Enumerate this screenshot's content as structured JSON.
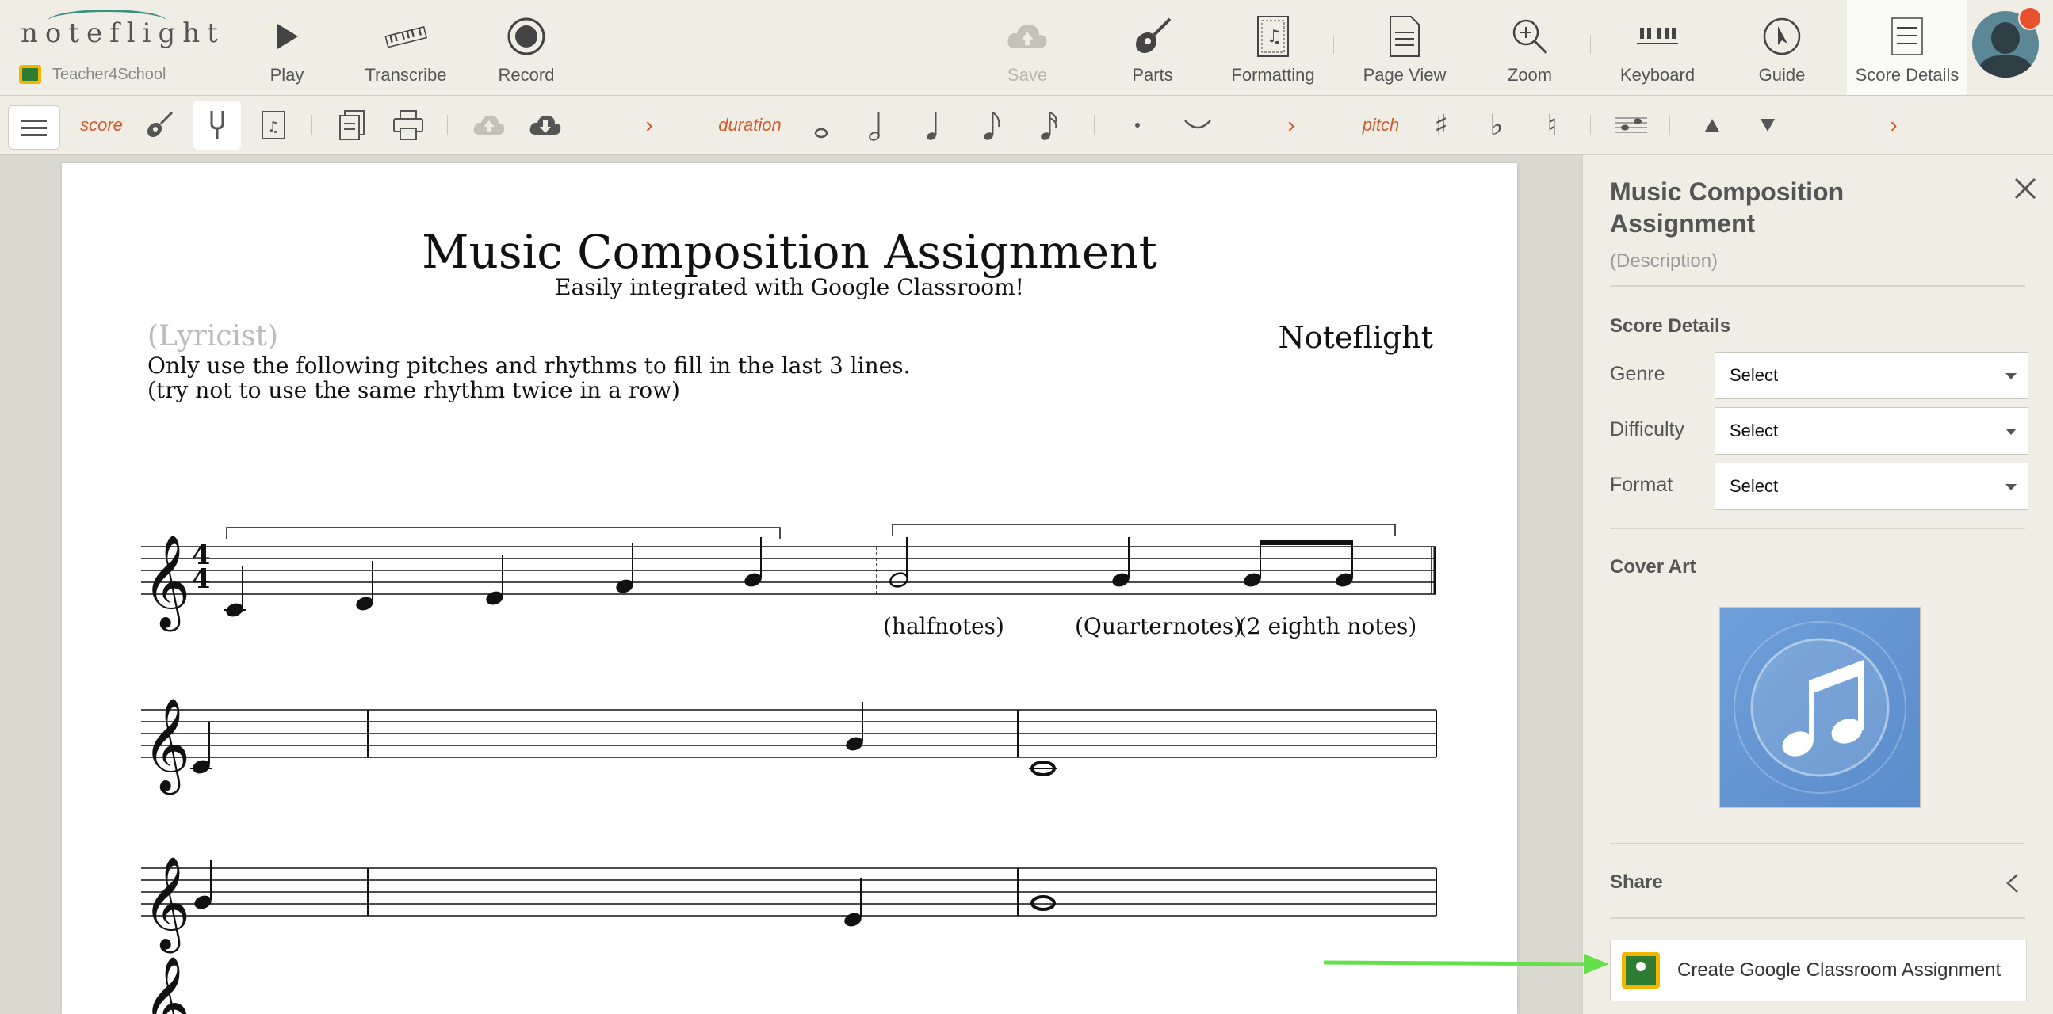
{
  "app": {
    "logo": "noteflight",
    "teacher_account": "Teacher4School"
  },
  "topbar": {
    "play": "Play",
    "transcribe": "Transcribe",
    "record": "Record",
    "save": "Save",
    "parts": "Parts",
    "formatting": "Formatting",
    "page_view": "Page View",
    "zoom": "Zoom",
    "keyboard": "Keyboard",
    "guide": "Guide",
    "score_details": "Score Details"
  },
  "toolbar2": {
    "score": "score",
    "duration": "duration",
    "pitch": "pitch"
  },
  "score": {
    "title": "Music Composition Assignment",
    "subtitle": "Easily integrated with Google Classroom!",
    "lyricist": "(Lyricist)",
    "composer": "Noteflight",
    "instruction_1": "Only use the following pitches and rhythms to fill in the last 3 lines.",
    "instruction_2": "(try not to use the same rhythm twice in a row)",
    "time_signature_top": "4",
    "time_signature_bottom": "4",
    "annotation_halfnotes": "(halfnotes)",
    "annotation_quarternotes": "(Quarternotes)",
    "annotation_eighth": "(2 eighth notes)"
  },
  "panel": {
    "title": "Music Composition Assignment",
    "description": "(Description)",
    "score_details_heading": "Score Details",
    "genre_label": "Genre",
    "genre_value": "Select",
    "difficulty_label": "Difficulty",
    "difficulty_value": "Select",
    "format_label": "Format",
    "format_value": "Select",
    "cover_art_heading": "Cover Art",
    "share_heading": "Share",
    "google_classroom_button": "Create Google Classroom Assignment"
  },
  "colors": {
    "accent_orange": "#d4582c",
    "arrow_green": "#66e04a",
    "background": "#efede4",
    "notification": "#e8502e"
  }
}
